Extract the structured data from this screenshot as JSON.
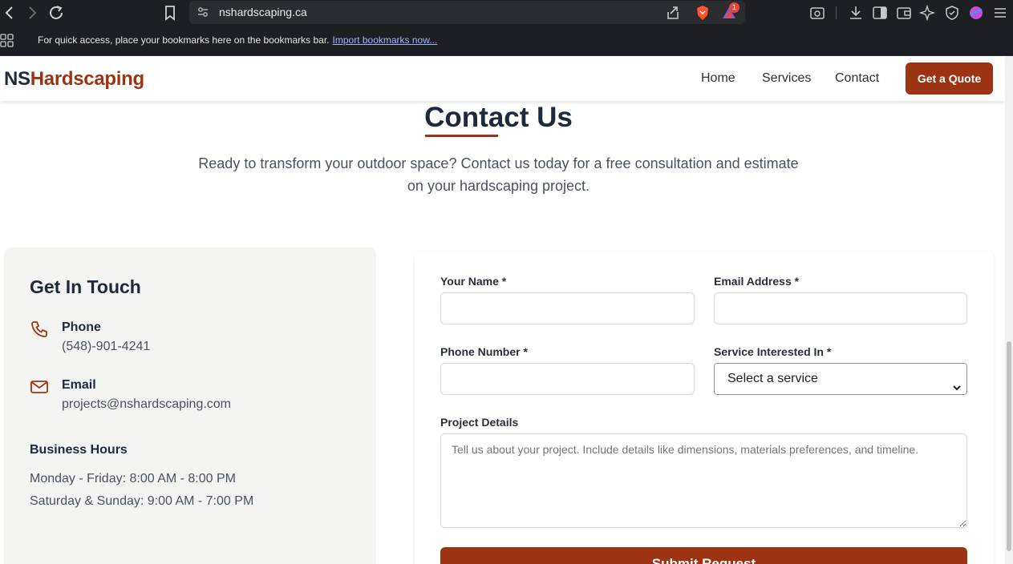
{
  "browser": {
    "url": "nshardscaping.ca",
    "notification_count": "1",
    "bookmarks_bar": {
      "message": "For quick access, place your bookmarks here on the bookmarks bar.",
      "import_link": "Import bookmarks now..."
    }
  },
  "site": {
    "logo": {
      "part1": "NS",
      "part2": "Hardscaping"
    },
    "nav": {
      "home": "Home",
      "services": "Services",
      "contact": "Contact",
      "quote_button": "Get a Quote"
    },
    "contact_section": {
      "title": "Contact Us",
      "intro": "Ready to transform your outdoor space? Contact us today for a free consultation and estimate on your hardscaping project."
    },
    "info_card": {
      "title": "Get In Touch",
      "phone_label": "Phone",
      "phone_value": "(548)-901-4241",
      "email_label": "Email",
      "email_value": "projects@nshardscaping.com",
      "hours_title": "Business Hours",
      "hours_weekdays": "Monday - Friday: 8:00 AM - 8:00 PM",
      "hours_weekend": "Saturday & Sunday: 9:00 AM - 7:00 PM"
    },
    "form": {
      "name_label": "Your Name *",
      "email_label": "Email Address *",
      "phone_label": "Phone Number *",
      "service_label": "Service Interested In *",
      "service_selected": "Select a service",
      "details_label": "Project Details",
      "details_placeholder": "Tell us about your project. Include details like dimensions, materials preferences, and timeline.",
      "submit_label": "Submit Request"
    }
  },
  "colors": {
    "brand_primary": "#9c3414",
    "brand_dark": "#1e2a3b",
    "card_background": "#f4f4f2",
    "browser_chrome": "#1e1f22"
  }
}
